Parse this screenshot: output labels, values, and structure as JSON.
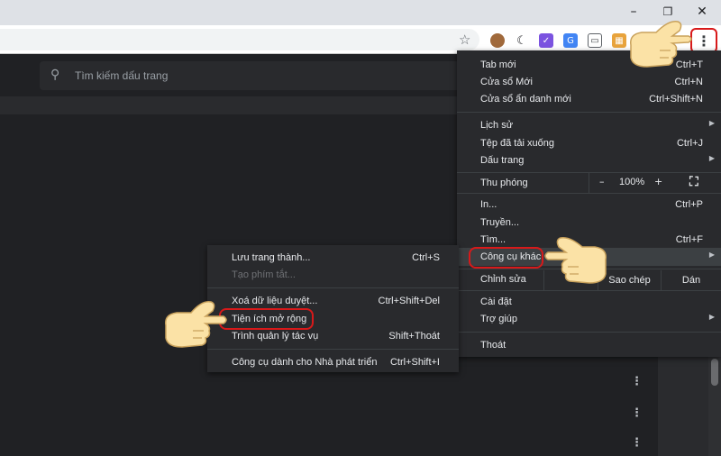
{
  "window": {
    "minimize_icon": "minimize-icon",
    "restore_icon": "restore-icon",
    "close_icon": "close-icon"
  },
  "search": {
    "placeholder": "Tìm kiếm dấu trang"
  },
  "main_menu": {
    "items_top": [
      {
        "label": "Tab mới",
        "shortcut": "Ctrl+T"
      },
      {
        "label": "Cửa sổ Mới",
        "shortcut": "Ctrl+N"
      },
      {
        "label": "Cửa sổ ẩn danh mới",
        "shortcut": "Ctrl+Shift+N"
      }
    ],
    "items_mid": [
      {
        "label": "Lịch sử",
        "shortcut": ""
      },
      {
        "label": "Tệp đã tải xuống",
        "shortcut": "Ctrl+J"
      },
      {
        "label": "Dấu trang",
        "shortcut": ""
      }
    ],
    "zoom": {
      "label": "Thu phóng",
      "minus": "–",
      "value": "100%",
      "plus": "+"
    },
    "items_print": [
      {
        "label": "In...",
        "shortcut": "Ctrl+P"
      },
      {
        "label": "Truyền...",
        "shortcut": ""
      },
      {
        "label": "Tìm...",
        "shortcut": "Ctrl+F"
      },
      {
        "label": "Công cụ khác",
        "shortcut": ""
      }
    ],
    "edit": {
      "label": "Chỉnh sửa",
      "cut": "",
      "copy": "Sao chép",
      "paste": "Dán"
    },
    "items_settings": [
      {
        "label": "Cài đặt",
        "shortcut": ""
      },
      {
        "label": "Trợ giúp",
        "shortcut": ""
      }
    ],
    "exit": {
      "label": "Thoát"
    }
  },
  "sub_menu": {
    "items": [
      {
        "label": "Lưu trang thành...",
        "shortcut": "Ctrl+S"
      },
      {
        "label": "Tạo phím tắt...",
        "shortcut": ""
      },
      {
        "label": "Xoá dữ liệu duyệt...",
        "shortcut": "Ctrl+Shift+Del"
      },
      {
        "label": "Tiện ích mở rộng",
        "shortcut": ""
      },
      {
        "label": "Trình quản lý tác vụ",
        "shortcut": "Shift+Thoát"
      },
      {
        "label": "Công cụ dành cho Nhà phát triển",
        "shortcut": "Ctrl+Shift+I"
      }
    ]
  },
  "colors": {
    "highlight": "#d8191a",
    "menu_bg": "#292a2d",
    "page_bg": "#202124"
  }
}
